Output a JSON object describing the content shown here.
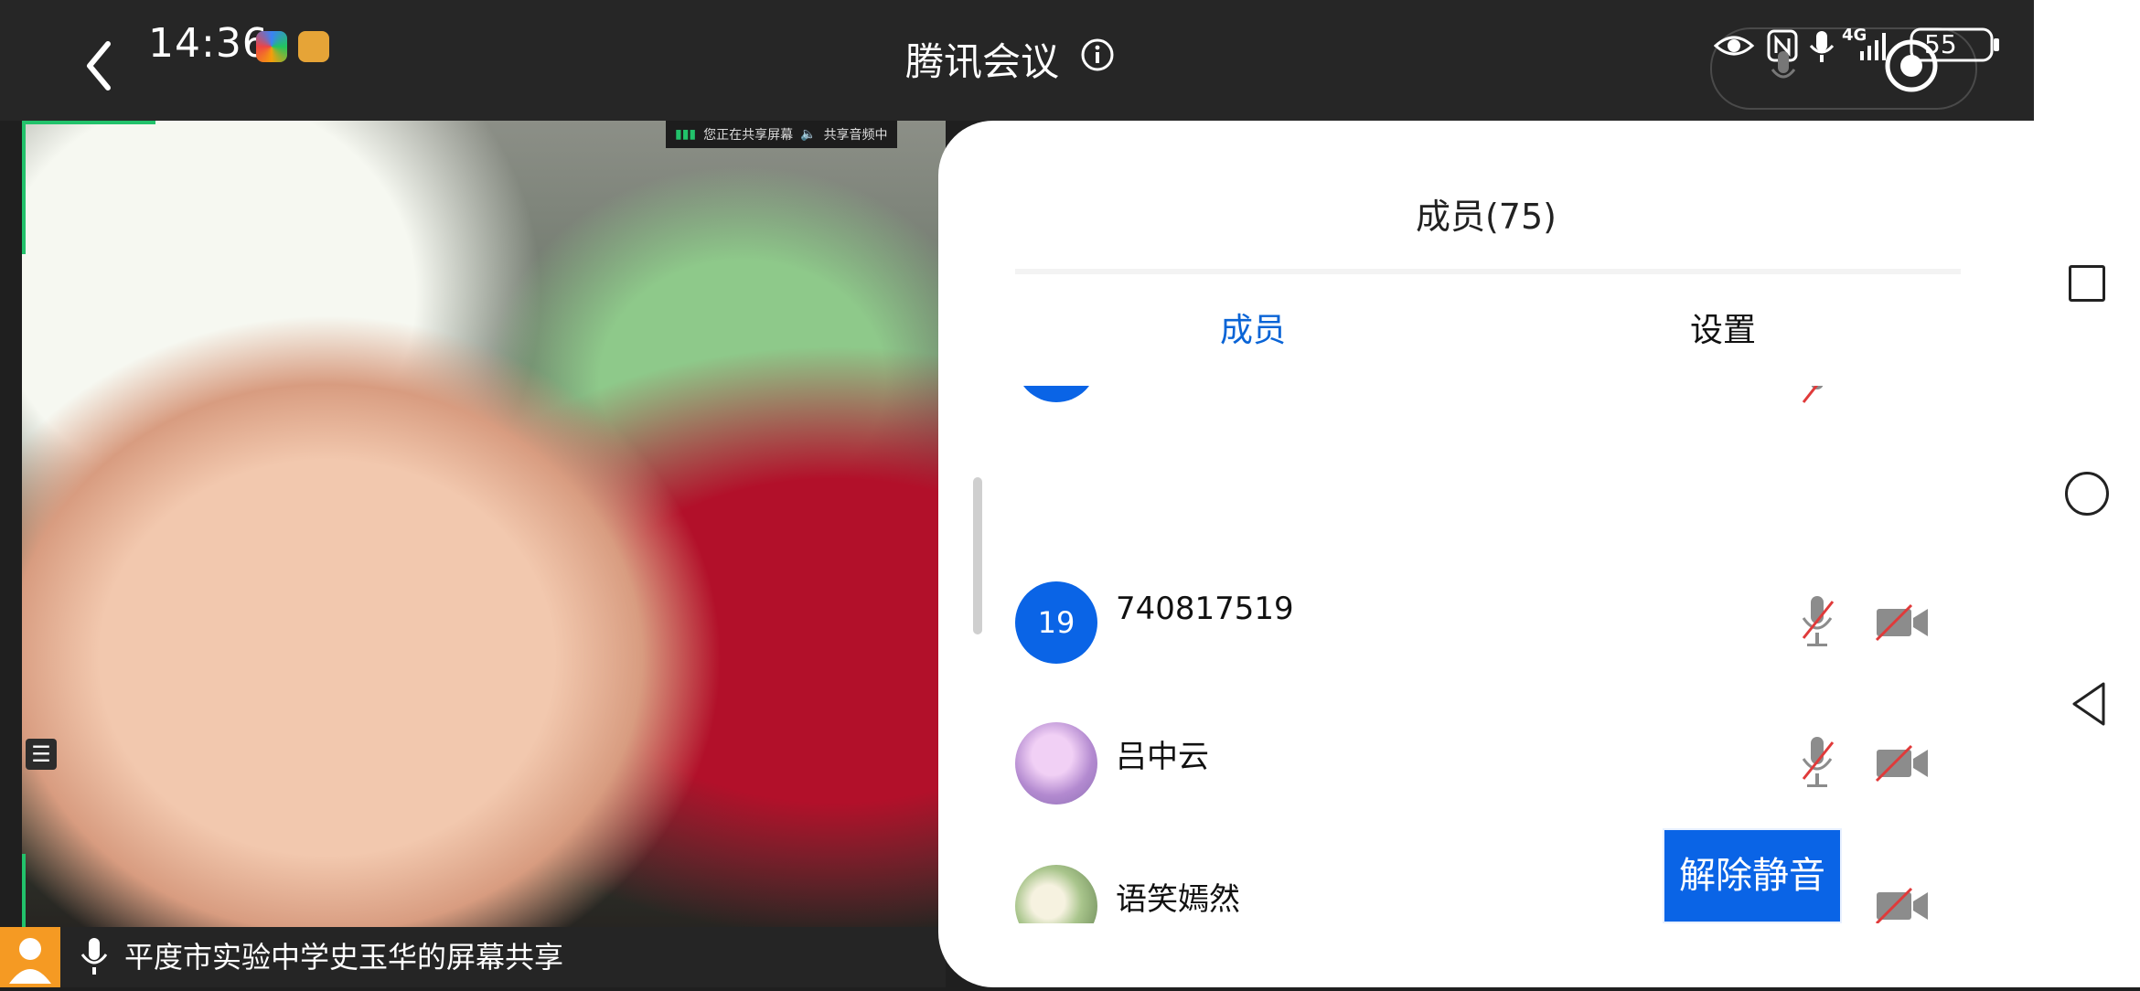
{
  "status": {
    "time": "14:36",
    "title": "腾讯会议",
    "net_type": "4G",
    "battery": "55"
  },
  "share_badge": {
    "sharing_text": "您正在共享屏幕",
    "audio_text": "共享音频中"
  },
  "share_bar": {
    "label": "平度市实验中学史玉华的屏幕共享"
  },
  "panel": {
    "title": "成员(75)",
    "tabs": [
      {
        "label": "成员",
        "active": true
      },
      {
        "label": "设置",
        "active": false
      }
    ],
    "members": [
      {
        "avatar_text": "19",
        "name": "740817519",
        "mic_muted": true,
        "camera_off": true
      },
      {
        "avatar_text": "",
        "name": "吕中云",
        "mic_muted": true,
        "camera_off": true
      },
      {
        "avatar_text": "",
        "name": "语笑嫣然",
        "mic_muted": true,
        "camera_off": true
      }
    ],
    "unmute_label": "解除静音"
  },
  "colors": {
    "accent": "#0a64e6",
    "muted_red": "#e03a3a",
    "highlight_green": "#22c26b"
  }
}
